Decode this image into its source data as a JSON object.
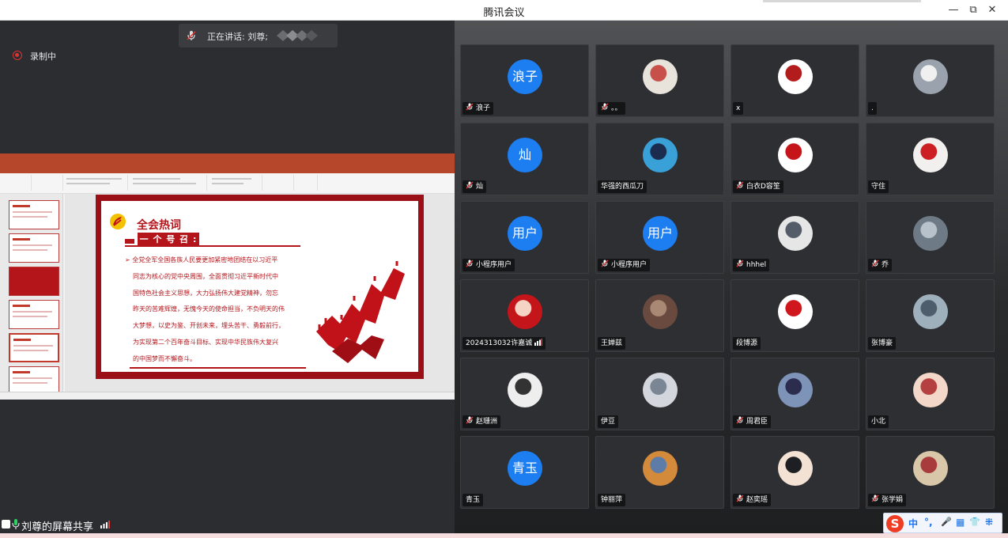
{
  "window": {
    "title": "腾讯会议"
  },
  "controls": {
    "minimize": "—",
    "restore": "⧉",
    "close": "✕"
  },
  "speaking": {
    "label": "正在讲话: 刘尊;"
  },
  "recording": {
    "label": "录制中"
  },
  "sharer": {
    "label": "刘尊的屏幕共享"
  },
  "slide": {
    "title": "全会热词",
    "header": "一 个 号 召 :",
    "lines": [
      "全党全军全国各族人民要更加紧密地团结在以习近平",
      "同志为核心的党中央周围，全面贯彻习近平新时代中",
      "国特色社会主义思想，大力弘扬伟大建党精神，勿忘",
      "昨天的苦难辉煌，无愧今天的使命担当，不负明天的伟",
      "大梦想，以史为鉴、开创未来，埋头苦干、勇毅前行，",
      "为实现第二个百年奋斗目标、实现中华民族伟大复兴",
      "的中国梦而不懈奋斗。"
    ],
    "arrow": "➢"
  },
  "participants": [
    {
      "name": "浪子",
      "avatar_text": "浪子",
      "muted": true
    },
    {
      "name": "。。",
      "avatar_text": "",
      "muted": true
    },
    {
      "name": "x",
      "avatar_text": "",
      "muted": false
    },
    {
      "name": ".",
      "avatar_text": "",
      "muted": false
    },
    {
      "name": "灿",
      "avatar_text": "灿",
      "muted": true
    },
    {
      "name": "华强的西瓜刀",
      "avatar_text": "",
      "muted": false
    },
    {
      "name": "白衣D容笙",
      "avatar_text": "",
      "muted": true
    },
    {
      "name": "守住",
      "avatar_text": "",
      "muted": false
    },
    {
      "name": "小程序用户",
      "avatar_text": "用户",
      "muted": true
    },
    {
      "name": "小程序用户",
      "avatar_text": "用户",
      "muted": true
    },
    {
      "name": "hhhel",
      "avatar_text": "",
      "muted": true
    },
    {
      "name": "乔",
      "avatar_text": "",
      "muted": true
    },
    {
      "name": "2024313032许嘉诚",
      "avatar_text": "",
      "muted": false,
      "signal": true
    },
    {
      "name": "王婵兹",
      "avatar_text": "",
      "muted": false
    },
    {
      "name": "段博源",
      "avatar_text": "",
      "muted": false
    },
    {
      "name": "张博豪",
      "avatar_text": "",
      "muted": false
    },
    {
      "name": "赵珊洲",
      "avatar_text": "",
      "muted": true
    },
    {
      "name": "伊豆",
      "avatar_text": "",
      "muted": false
    },
    {
      "name": "周君臣",
      "avatar_text": "",
      "muted": true
    },
    {
      "name": "小北",
      "avatar_text": "",
      "muted": false
    },
    {
      "name": "青玉",
      "avatar_text": "青玉",
      "muted": false
    },
    {
      "name": "钟丽萍",
      "avatar_text": "",
      "muted": false
    },
    {
      "name": "赵奕瑶",
      "avatar_text": "",
      "muted": true
    },
    {
      "name": "张学娟",
      "avatar_text": "",
      "muted": true
    }
  ],
  "colors": {
    "accent_blue": "#1d7ef2",
    "ppt_red": "#b7472a",
    "slide_red": "#b3151b"
  },
  "ime": {
    "lang": "中",
    "punct": "°,",
    "mic": "🎤",
    "kbd": "▦",
    "shirt": "👕",
    "apps": "⁜"
  }
}
